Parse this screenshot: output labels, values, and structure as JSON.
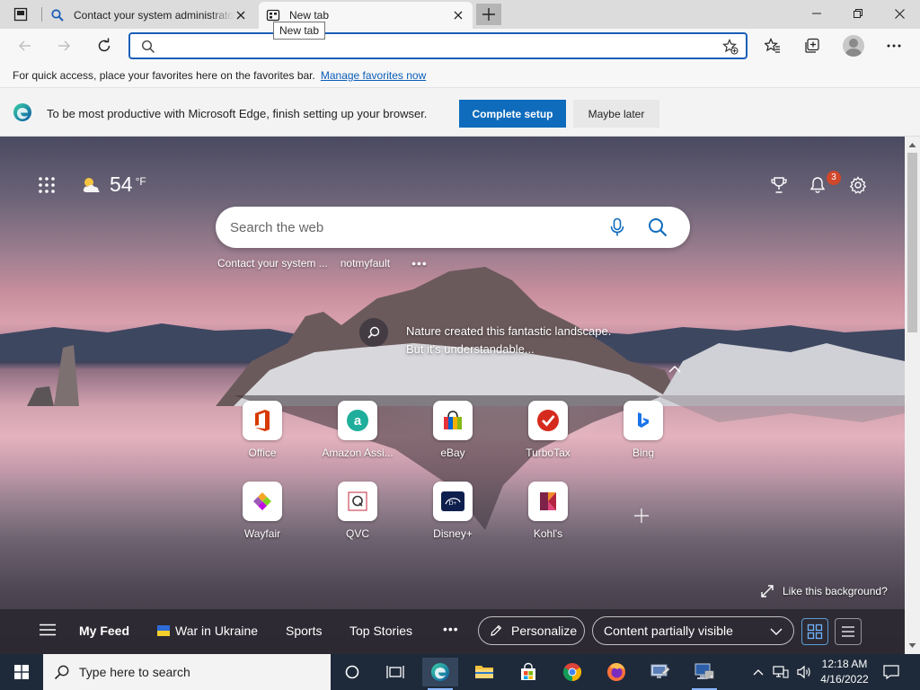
{
  "browser": {
    "tabs": [
      {
        "title": "Contact your system administrator"
      },
      {
        "title": "New tab"
      }
    ],
    "tooltip": "New tab"
  },
  "address_bar": {
    "value": "",
    "placeholder": ""
  },
  "favorites_bar": {
    "text": "For quick access, place your favorites here on the favorites bar.",
    "link": "Manage favorites now"
  },
  "setup_banner": {
    "message": "To be most productive with Microsoft Edge, finish setting up your browser.",
    "primary": "Complete setup",
    "secondary": "Maybe later"
  },
  "ntp": {
    "weather": {
      "temp": "54",
      "unit": "°F"
    },
    "notification_count": "3",
    "search": {
      "placeholder": "Search the web"
    },
    "quick_links": [
      "Contact your system ...",
      "notmyfault"
    ],
    "caption": {
      "line1": "Nature created this fantastic landscape.",
      "line2": "But it's understandable..."
    },
    "tiles": [
      {
        "label": "Office",
        "icon": "office-icon"
      },
      {
        "label": "Amazon Assi...",
        "icon": "amazon-icon"
      },
      {
        "label": "eBay",
        "icon": "ebay-icon"
      },
      {
        "label": "TurboTax",
        "icon": "turbotax-icon"
      },
      {
        "label": "Bing",
        "icon": "bing-icon"
      },
      {
        "label": "Wayfair",
        "icon": "wayfair-icon"
      },
      {
        "label": "QVC",
        "icon": "qvc-icon"
      },
      {
        "label": "Disney+",
        "icon": "disney-icon"
      },
      {
        "label": "Kohl's",
        "icon": "kohls-icon"
      }
    ],
    "like_background": "Like this background?",
    "feed": {
      "tabs": [
        "My Feed",
        "War in Ukraine",
        "Sports",
        "Top Stories"
      ],
      "personalize": "Personalize",
      "visibility": "Content partially visible"
    }
  },
  "taskbar": {
    "search_placeholder": "Type here to search",
    "time": "12:18 AM",
    "date": "4/16/2022"
  },
  "colors": {
    "accent": "#0f6cbd",
    "address_border": "#1b5fb8",
    "taskbar": "#1e2a3a",
    "badge": "#d0472c"
  }
}
